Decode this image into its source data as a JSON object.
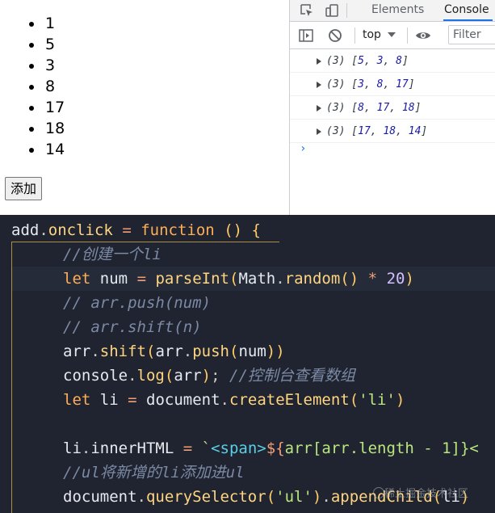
{
  "page": {
    "list_items": [
      "1",
      "5",
      "3",
      "8",
      "17",
      "18",
      "14"
    ],
    "add_button_label": "添加"
  },
  "devtools": {
    "tabs": [
      {
        "label": "Elements",
        "active": false
      },
      {
        "label": "Console",
        "active": true
      }
    ],
    "context": "top",
    "filter_placeholder": "Filter",
    "console_logs": [
      {
        "count": "(3)",
        "values": [
          "5",
          "3",
          "8"
        ]
      },
      {
        "count": "(3)",
        "values": [
          "3",
          "8",
          "17"
        ]
      },
      {
        "count": "(3)",
        "values": [
          "8",
          "17",
          "18"
        ]
      },
      {
        "count": "(3)",
        "values": [
          "17",
          "18",
          "14"
        ]
      }
    ],
    "prompt": "›"
  },
  "editor": {
    "lines": [
      "add.onclick = function () {",
      "//创建一个li",
      "let num = parseInt(Math.random() * 20)",
      "// arr.push(num)",
      "// arr.shift(n)",
      "arr.shift(arr.push(num))",
      "console.log(arr); //控制台查看数组",
      "let li = document.createElement('li')",
      "",
      "li.innerHTML = `<span>${arr[arr.length - 1]}<",
      "//ul将新增的li添加进ul",
      "document.querySelector('ul').appendChild(li)"
    ]
  },
  "watermark": "稀土掘金技术社区",
  "colors": {
    "devtools_accent": "#1a73e8",
    "editor_bg": "#1f2430",
    "keyword": "#ffae57",
    "string": "#bae67e",
    "number": "#d4bfff",
    "comment": "#7c8aa5"
  }
}
